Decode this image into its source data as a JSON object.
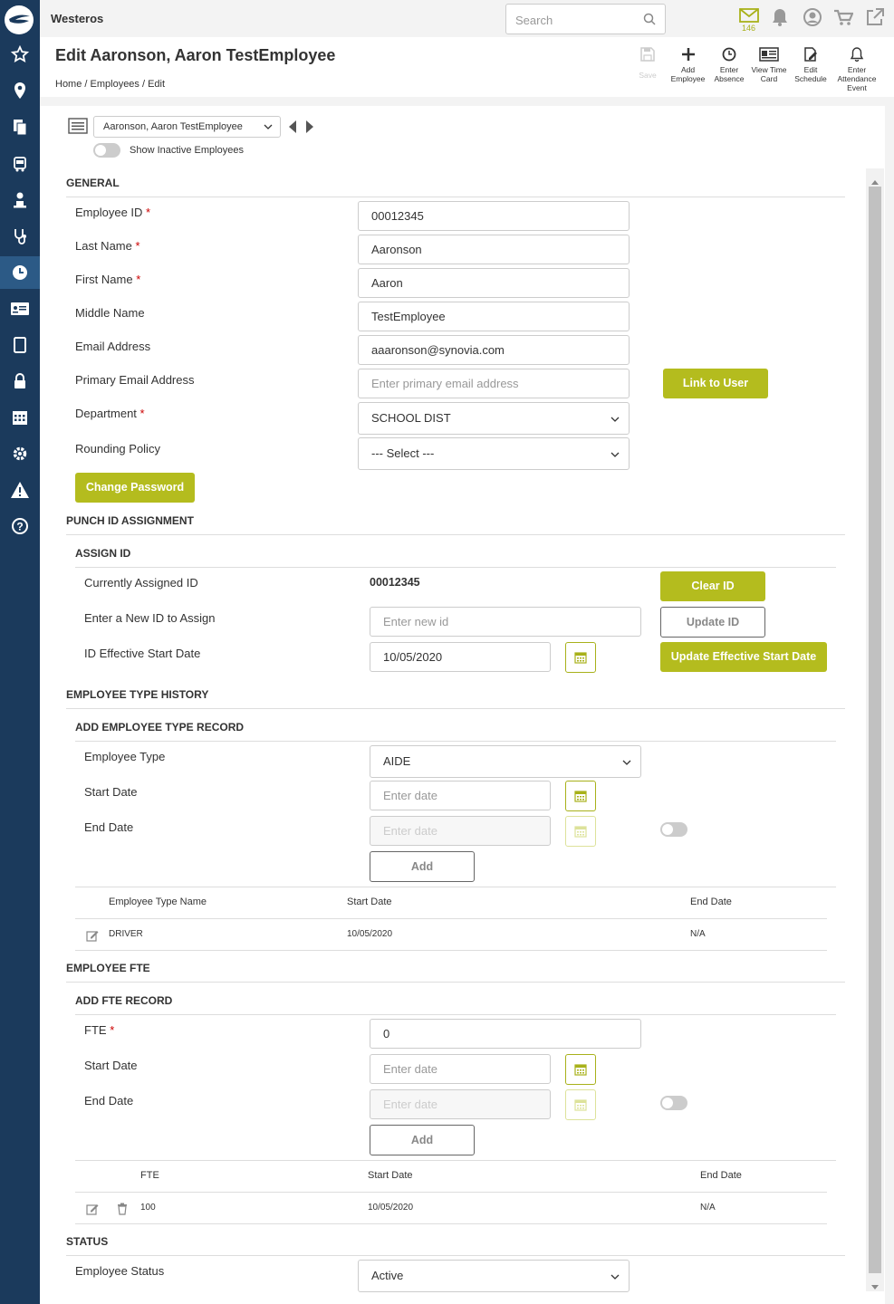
{
  "topbar": {
    "brand": "Westeros",
    "search_placeholder": "Search",
    "mail_count": "146"
  },
  "header": {
    "title": "Edit Aaronson, Aaron TestEmployee",
    "breadcrumb": "Home / Employees / Edit",
    "toolbar": [
      {
        "label1": "Save",
        "label2": ""
      },
      {
        "label1": "Add",
        "label2": "Employee"
      },
      {
        "label1": "Enter",
        "label2": "Absence"
      },
      {
        "label1": "View Time",
        "label2": "Card"
      },
      {
        "label1": "Edit",
        "label2": "Schedule"
      },
      {
        "label1": "Enter",
        "label2": "Attendance",
        "label3": "Event"
      }
    ]
  },
  "selector": {
    "employee": "Aaronson, Aaron TestEmployee",
    "show_inactive": "Show Inactive Employees"
  },
  "general": {
    "title": "GENERAL",
    "fields": [
      {
        "label": "Employee ID",
        "value": "00012345"
      },
      {
        "label": "Last Name",
        "value": "Aaronson"
      },
      {
        "label": "First Name",
        "value": "Aaron"
      },
      {
        "label": "Middle Name",
        "value": "TestEmployee"
      },
      {
        "label": "Email Address",
        "value": "aaaronson@synovia.com"
      },
      {
        "label": "Primary Email Address",
        "placeholder": "Enter primary email address"
      },
      {
        "label": "Department",
        "value": "SCHOOL DIST"
      },
      {
        "label": "Rounding Policy",
        "value": "--- Select ---"
      }
    ],
    "link_to_user": "Link to User",
    "change_password": "Change Password"
  },
  "punch": {
    "title": "PUNCH ID ASSIGNMENT",
    "subtitle": "ASSIGN ID",
    "current_label": "Currently Assigned ID",
    "current_value": "00012345",
    "new_label": "Enter a New ID to Assign",
    "new_placeholder": "Enter new id",
    "start_label": "ID Effective Start Date",
    "start_value": "10/05/2020",
    "clear_id": "Clear ID",
    "update_id": "Update ID",
    "update_start": "Update Effective Start Date"
  },
  "emp_type": {
    "title": "EMPLOYEE TYPE HISTORY",
    "subtitle": "ADD EMPLOYEE TYPE RECORD",
    "type_label": "Employee Type",
    "type_value": "AIDE",
    "start_label": "Start Date",
    "end_label": "End Date",
    "date_placeholder": "Enter date",
    "add": "Add",
    "columns": [
      "Employee Type Name",
      "Start Date",
      "End Date"
    ],
    "rows": [
      {
        "name": "DRIVER",
        "start": "10/05/2020",
        "end": "N/A"
      }
    ]
  },
  "fte": {
    "title": "EMPLOYEE FTE",
    "subtitle": "ADD FTE RECORD",
    "fte_label": "FTE",
    "fte_value": "0",
    "start_label": "Start Date",
    "end_label": "End Date",
    "date_placeholder": "Enter date",
    "add": "Add",
    "columns": [
      "FTE",
      "Start Date",
      "End Date"
    ],
    "rows": [
      {
        "fte": "100",
        "start": "10/05/2020",
        "end": "N/A"
      }
    ]
  },
  "status": {
    "title": "STATUS",
    "label": "Employee Status",
    "value": "Active"
  },
  "colors": {
    "sidebar": "#1b3a5c",
    "accent": "#b4bc1e",
    "required": "#cc0000"
  }
}
